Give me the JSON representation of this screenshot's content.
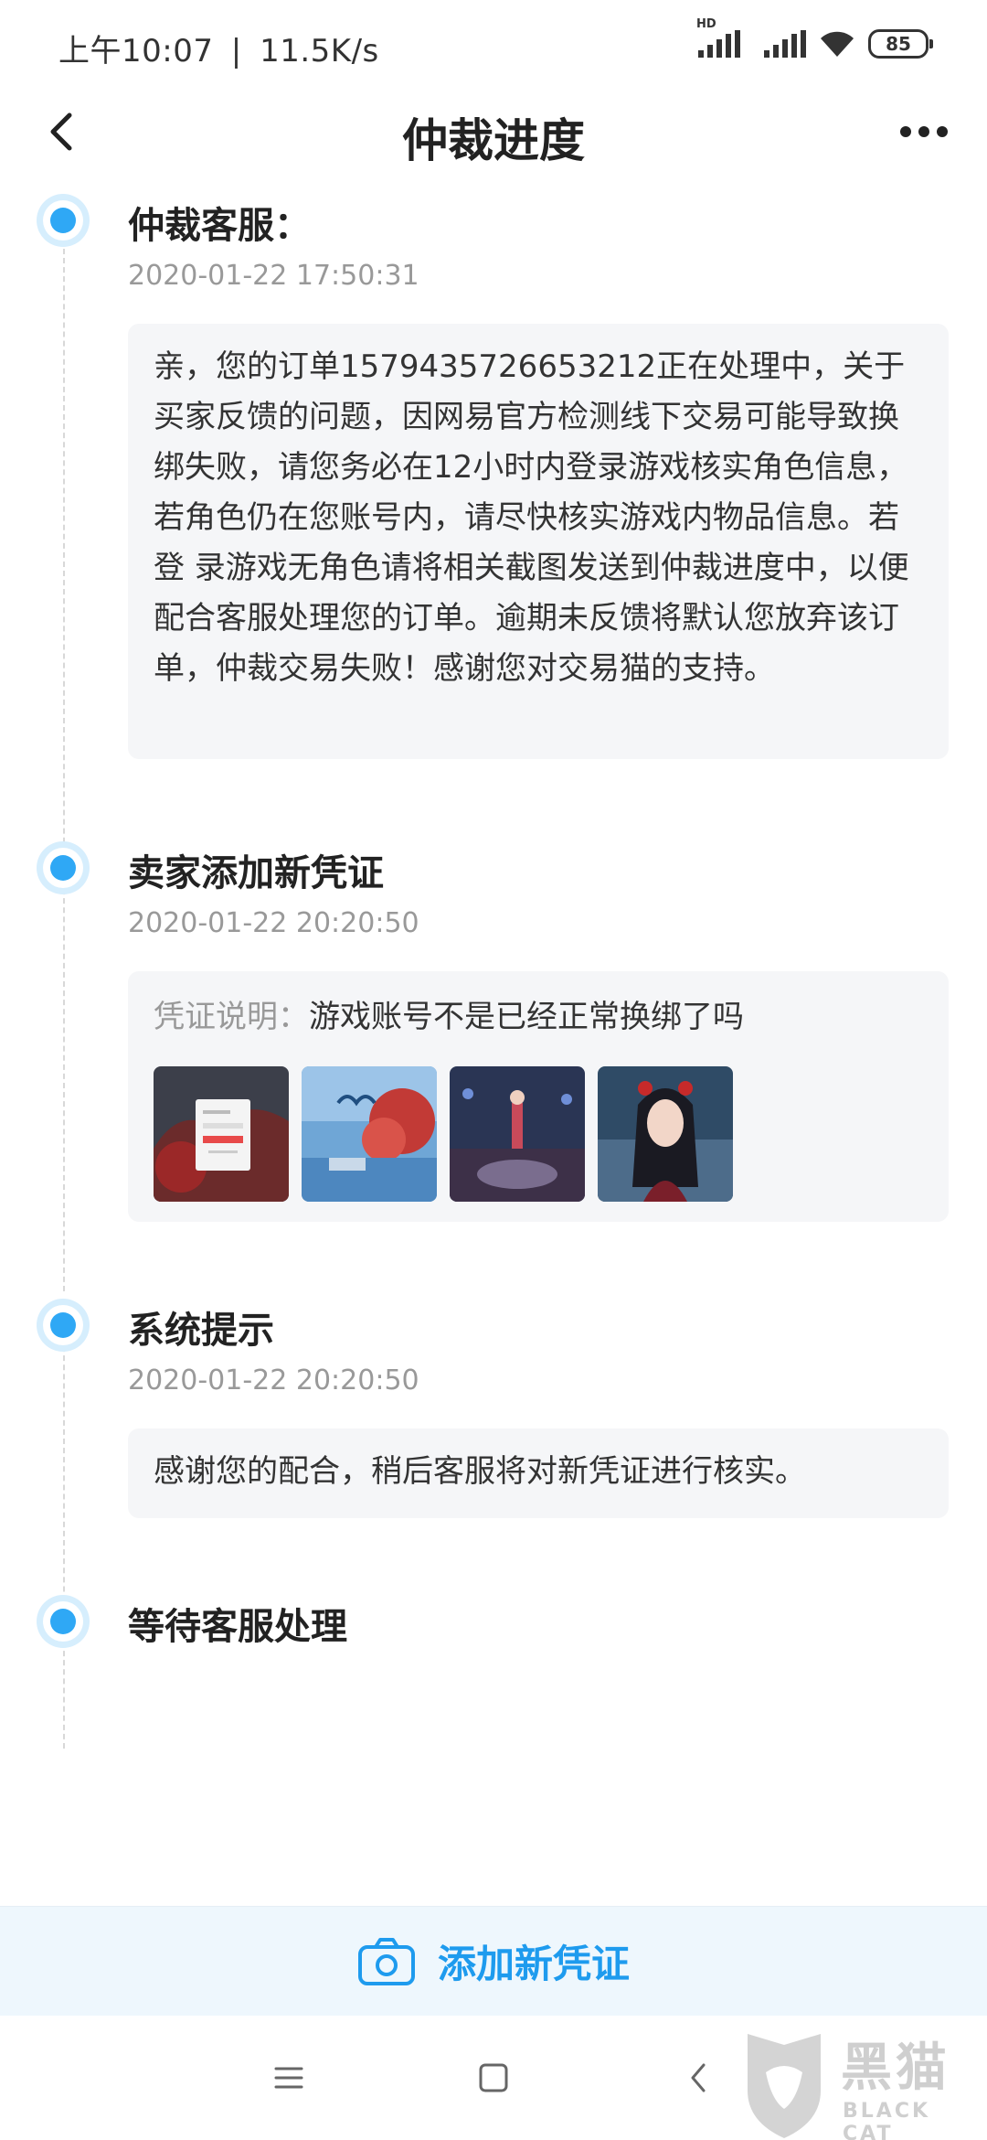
{
  "status_bar": {
    "time": "上午10:07",
    "separator": "|",
    "speed": "11.5K/s",
    "network_label": "HD",
    "battery": "85"
  },
  "nav": {
    "title": "仲裁进度",
    "back_icon": "chevron-left-icon",
    "more_icon": "more-dots-icon"
  },
  "timeline": [
    {
      "title": "仲裁客服：",
      "time": "2020-01-22 17:50:31",
      "message": "亲，您的订单1579435726653212正在处理中，关于买家反馈的问题，因网易官方检测线下交易可能导致换绑失败，请您务必在12小时内登录游戏核实角色信息，若角色仍在您账号内，请尽快核实游戏内物品信息。若登 录游戏无角色请将相关截图发送到仲裁进度中，以便配合客服处理您的订单。逾期未反馈将默认您放弃该订单，仲裁交易失败！感谢您对交易猫的支持。"
    },
    {
      "title": "卖家添加新凭证",
      "time": "2020-01-22 20:20:50",
      "evidence_label": "凭证说明：",
      "evidence_text": "游戏账号不是已经正常换绑了吗",
      "thumbnails": [
        "login-screenshot",
        "game-title-screenshot",
        "character-scene-screenshot",
        "character-portrait-screenshot"
      ]
    },
    {
      "title": "系统提示",
      "time": "2020-01-22 20:20:50",
      "message": "感谢您的配合，稍后客服将对新凭证进行核实。"
    },
    {
      "title": "等待客服处理"
    }
  ],
  "action": {
    "label": "添加新凭证",
    "icon": "camera-icon"
  },
  "watermark": {
    "text": "黑猫",
    "sub": "BLACK CAT"
  },
  "colors": {
    "accent": "#2fa8f5",
    "action_text": "#1e9bee",
    "card_bg": "#f5f6f8",
    "action_bg": "#eef7fd"
  }
}
